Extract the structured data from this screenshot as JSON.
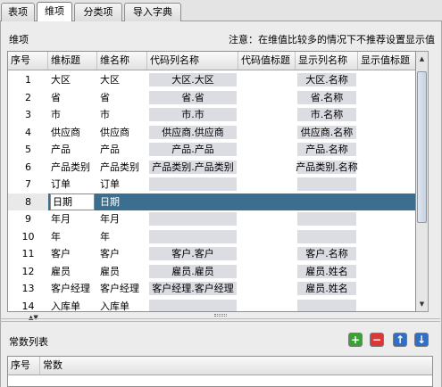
{
  "tabs": [
    {
      "label": "表项"
    },
    {
      "label": "维项"
    },
    {
      "label": "分类项"
    },
    {
      "label": "导入字典"
    }
  ],
  "dimension_section": {
    "title": "维项",
    "notice": "注意：在维值比较多的情况下不推荐设置显示值"
  },
  "dim_table": {
    "headers": [
      "序号",
      "维标题",
      "维名称",
      "代码列名称",
      "代码值标题",
      "显示列名称",
      "显示值标题"
    ],
    "rows": [
      {
        "no": "1",
        "title": "大区",
        "name": "大区",
        "code_col": "大区.大区",
        "display_col": "大区.名称"
      },
      {
        "no": "2",
        "title": "省",
        "name": "省",
        "code_col": "省.省",
        "display_col": "省.名称"
      },
      {
        "no": "3",
        "title": "市",
        "name": "市",
        "code_col": "市.市",
        "display_col": "市.名称"
      },
      {
        "no": "4",
        "title": "供应商",
        "name": "供应商",
        "code_col": "供应商.供应商",
        "display_col": "供应商.名称"
      },
      {
        "no": "5",
        "title": "产品",
        "name": "产品",
        "code_col": "产品.产品",
        "display_col": "产品.名称"
      },
      {
        "no": "6",
        "title": "产品类别",
        "name": "产品类别",
        "code_col": "产品类别.产品类别",
        "display_col": "产品类别.名称"
      },
      {
        "no": "7",
        "title": "订单",
        "name": "订单",
        "code_col": "",
        "display_col": ""
      },
      {
        "no": "8",
        "title": "日期",
        "name": "日期",
        "code_col": "",
        "display_col": ""
      },
      {
        "no": "9",
        "title": "年月",
        "name": "年月",
        "code_col": "",
        "display_col": ""
      },
      {
        "no": "10",
        "title": "年",
        "name": "年",
        "code_col": "",
        "display_col": ""
      },
      {
        "no": "11",
        "title": "客户",
        "name": "客户",
        "code_col": "客户.客户",
        "display_col": "客户.名称"
      },
      {
        "no": "12",
        "title": "雇员",
        "name": "雇员",
        "code_col": "雇员.雇员",
        "display_col": "雇员.姓名"
      },
      {
        "no": "13",
        "title": "客户经理",
        "name": "客户经理",
        "code_col": "客户经理.客户经理",
        "display_col": "雇员.姓名"
      },
      {
        "no": "14",
        "title": "入库单",
        "name": "入库单",
        "code_col": "",
        "display_col": ""
      }
    ],
    "selected_row": "8"
  },
  "constant_section": {
    "title": "常数列表",
    "buttons": [
      {
        "icon": "add-icon",
        "color": "#3aa235"
      },
      {
        "icon": "remove-icon",
        "color": "#d83a3a"
      },
      {
        "icon": "arrow-up-icon",
        "color": "#2f6fc8"
      },
      {
        "icon": "arrow-down-icon",
        "color": "#2f6fc8"
      }
    ],
    "headers": [
      "序号",
      "常数"
    ]
  },
  "colors": {
    "selection": "#3b6e8f",
    "shaded_cell": "#dcdde3"
  }
}
